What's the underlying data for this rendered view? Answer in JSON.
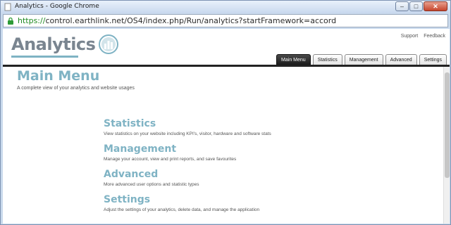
{
  "window": {
    "title": "Analytics - Google Chrome",
    "buttons": {
      "minimize": "–",
      "maximize": "□",
      "close": "✕"
    }
  },
  "address_bar": {
    "protocol": "https://",
    "url_rest": "control.earthlink.net/OS4/index.php/Run/analytics?startFramework=accord"
  },
  "header": {
    "logo_text": "Analytics",
    "links": [
      "Support",
      "Feedback"
    ],
    "tabs": [
      {
        "label": "Main Menu",
        "active": true
      },
      {
        "label": "Statistics",
        "active": false
      },
      {
        "label": "Management",
        "active": false
      },
      {
        "label": "Advanced",
        "active": false
      },
      {
        "label": "Settings",
        "active": false
      }
    ]
  },
  "main": {
    "title": "Main Menu",
    "subtitle": "A complete view of your analytics and website usages",
    "items": [
      {
        "title": "Statistics",
        "description": "View statistics on your website including KPI's, visitor, hardware and software stats"
      },
      {
        "title": "Management",
        "description": "Manage your account, view and print reports, and save favourites"
      },
      {
        "title": "Advanced",
        "description": "More advanced user options and statistic types"
      },
      {
        "title": "Settings",
        "description": "Adjust the settings of your analytics, delete data, and manage the application"
      }
    ]
  },
  "colors": {
    "accent": "#7fb3c4",
    "tab_active": "#1b1b1b",
    "logo": "#7a8590"
  }
}
